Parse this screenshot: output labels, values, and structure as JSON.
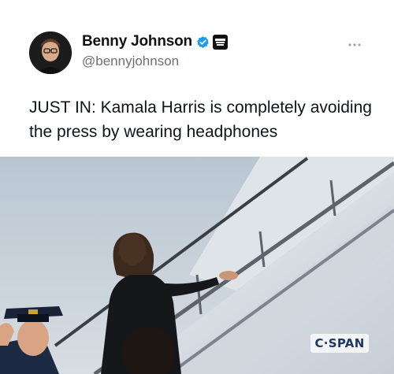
{
  "post": {
    "author_name": "Benny Johnson",
    "author_handle": "@bennyjohnson",
    "verified_icon": "verified-badge-icon",
    "affiliation_icon": "affiliate-badge-icon",
    "text": "JUST IN: Kamala Harris is completely avoiding the press by wearing headphones",
    "more_icon": "more-options-icon"
  },
  "media": {
    "watermark": "C·SPAN",
    "description_icon": "photo"
  },
  "colors": {
    "verified_blue": "#1d9bf0",
    "handle_gray": "#6b7177",
    "text": "#0f1419",
    "cspan_blue": "#1d3866"
  }
}
